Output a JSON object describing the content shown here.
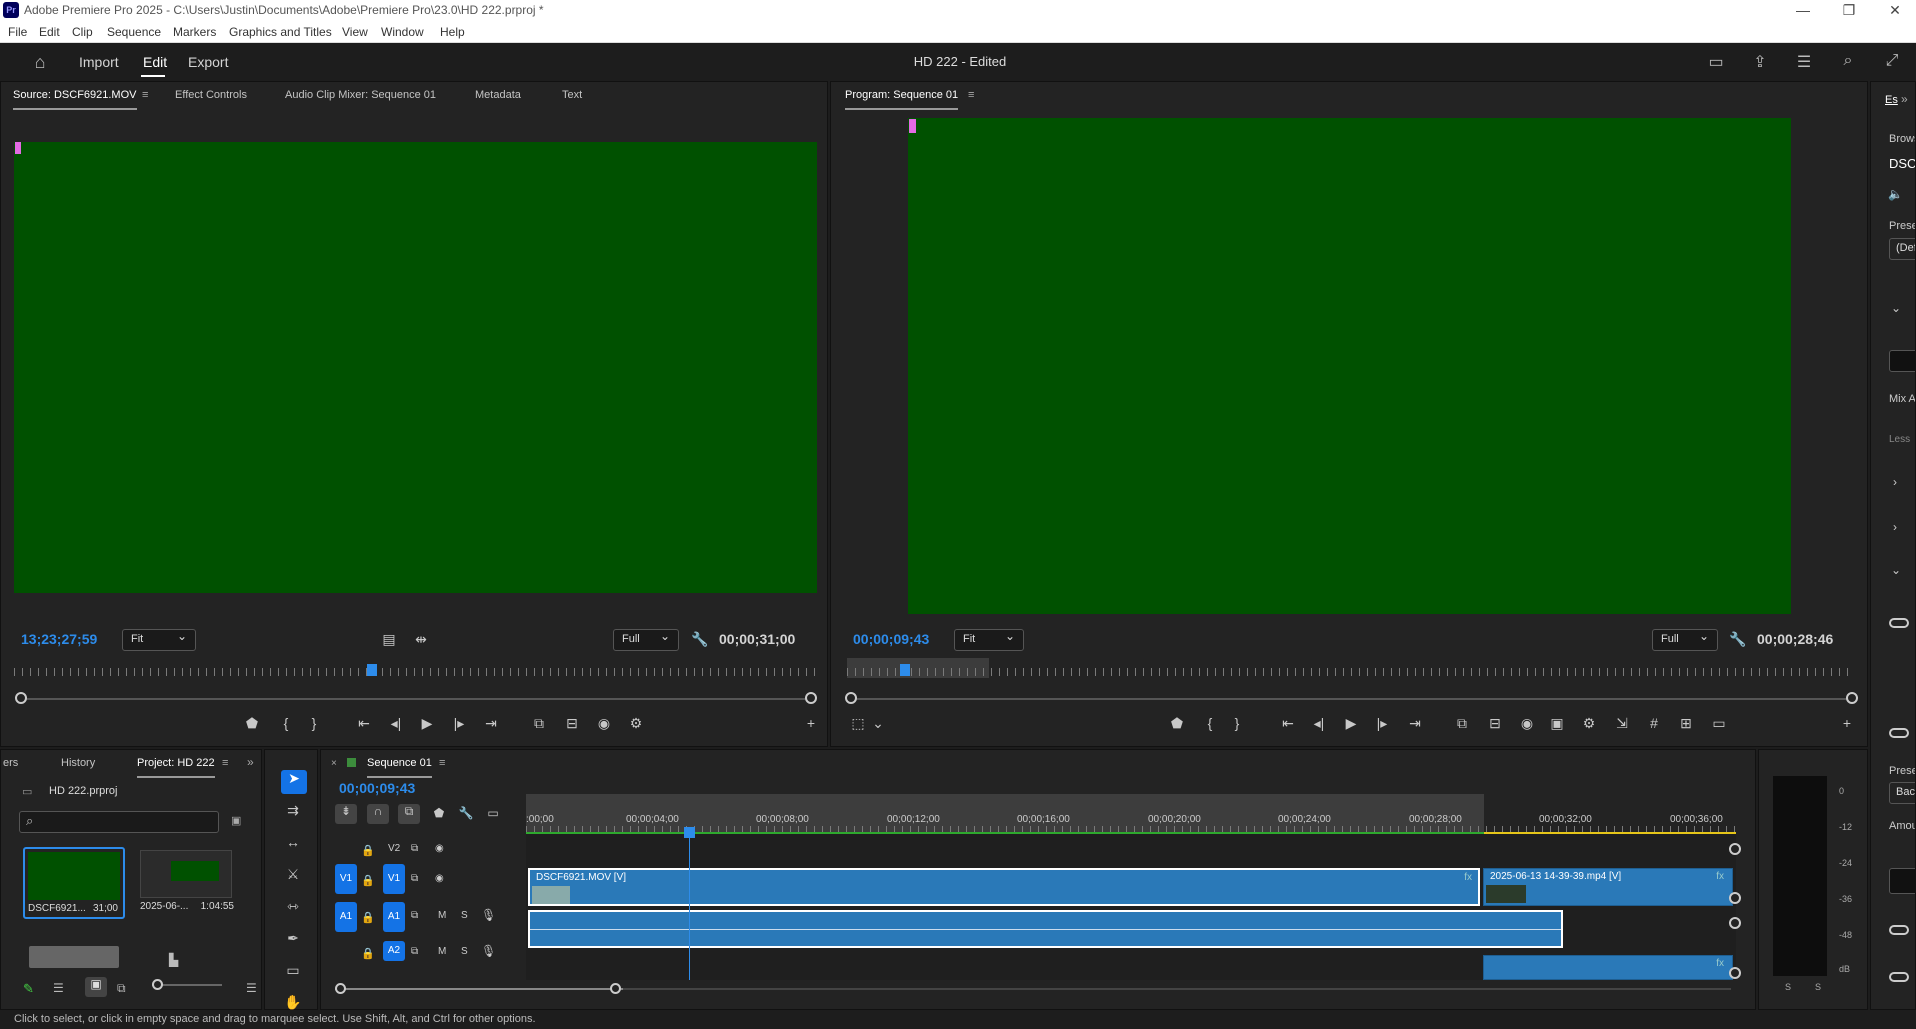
{
  "window": {
    "title": "Adobe Premiere Pro 2025 - C:\\Users\\Justin\\Documents\\Adobe\\Premiere Pro\\23.0\\HD 222.prproj *",
    "logo": "Pr"
  },
  "menu": [
    "File",
    "Edit",
    "Clip",
    "Sequence",
    "Markers",
    "Graphics and Titles",
    "View",
    "Window",
    "Help"
  ],
  "header": {
    "tabs": [
      "Import",
      "Edit",
      "Export"
    ],
    "active_tab": "Edit",
    "project_title": "HD 222 - Edited"
  },
  "source": {
    "tabs": [
      "Source: DSCF6921.MOV",
      "Effect Controls",
      "Audio Clip Mixer: Sequence 01",
      "Metadata",
      "Text"
    ],
    "timecode": "13;23;27;59",
    "zoom": "Fit",
    "resolution": "Full",
    "duration": "00;00;31;00"
  },
  "program": {
    "tab": "Program: Sequence 01",
    "timecode": "00;00;09;43",
    "zoom": "Fit",
    "resolution": "Full",
    "duration": "00;00;28;46"
  },
  "project": {
    "tabs": [
      "ers",
      "History",
      "Project: HD 222"
    ],
    "file": "HD 222.prproj",
    "items": [
      {
        "name": "DSCF6921...",
        "duration": "31;00"
      },
      {
        "name": "2025-06-...",
        "duration": "1:04:55"
      }
    ]
  },
  "timeline": {
    "tab": "Sequence 01",
    "timecode": "00;00;09;43",
    "ruler_labels": [
      ":00;00",
      "00;00;04;00",
      "00;00;08;00",
      "00;00;12;00",
      "00;00;16;00",
      "00;00;20;00",
      "00;00;24;00",
      "00;00;28;00",
      "00;00;32;00",
      "00;00;36;00"
    ],
    "tracks": {
      "v2": "V2",
      "v1": "V1",
      "a1": "A1",
      "a2": "A2",
      "m": "M",
      "s": "S"
    },
    "clips": {
      "v1a": "DSCF6921.MOV [V]",
      "v1b": "2025-06-13 14-39-39.mp4 [V]",
      "fx": "fx"
    }
  },
  "meter": {
    "labels": [
      "0",
      "-12",
      "-24",
      "-36",
      "-48",
      "dB"
    ],
    "channels": [
      "S",
      "S"
    ]
  },
  "essential": {
    "tab": "Es",
    "labels": [
      "Brows",
      "DSCF",
      "Prese",
      "(Def",
      "Mix A",
      "Less",
      "Prese",
      "Bac",
      "Amou"
    ]
  },
  "status_text": "Click to select, or click in empty space and drag to marquee select. Use Shift, Alt, and Ctrl for other options.",
  "colors": {
    "accent": "#2d8ceb",
    "video_green": "#005100",
    "clip_blue": "#2a79b8",
    "track_blue": "#1473e6"
  }
}
